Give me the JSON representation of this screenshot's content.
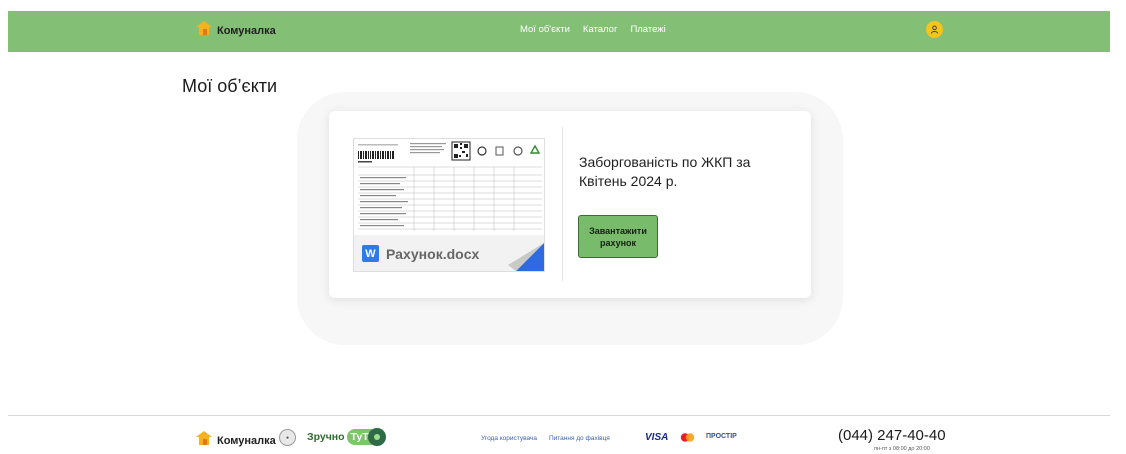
{
  "header": {
    "brand": "Комуналка",
    "nav": [
      "Мої об'єкти",
      "Каталог",
      "Платежі"
    ]
  },
  "page": {
    "title": "Мої об’єкти"
  },
  "card": {
    "document_name": "Рахунок.docx",
    "document_badge": "W",
    "debt_title": "Заборгованість по ЖКП за Квітень 2024 р.",
    "download_button": "Завантажити рахунок"
  },
  "footer": {
    "brand": "Комуналка",
    "partner_1": "Зручно",
    "partner_2": "ТуТ",
    "links": [
      "Угода користувача",
      "Питання до фахівця"
    ],
    "payments": {
      "visa": "VISA",
      "prostir": "ПРОСТІР"
    },
    "phone": "(044) 247-40-40",
    "hours": "пн-пт з 08:00 до 20:00"
  },
  "colors": {
    "header_bg": "#84bf76",
    "button_bg": "#77bb6b",
    "avatar": "#f5c51c",
    "link": "#3d63b0"
  },
  "icons": [
    "house-logo-icon",
    "user-icon",
    "word-file-icon",
    "mastercard-icon"
  ]
}
